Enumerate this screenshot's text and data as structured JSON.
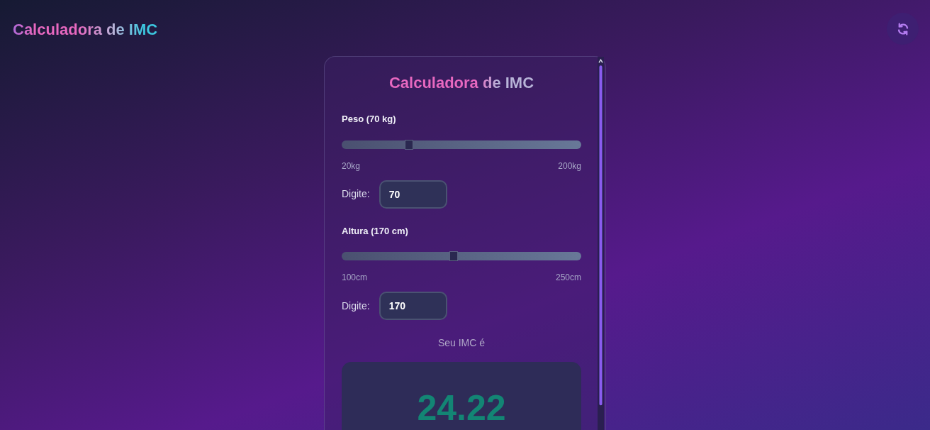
{
  "header": {
    "title": "Calculadora de IMC"
  },
  "card": {
    "title": "Calculadora de IMC",
    "sliders": [
      {
        "label": "Peso (70 kg)",
        "level": 0.28,
        "min_label": "20kg",
        "max_label": "200kg",
        "input_label": "Digite:",
        "value": "70"
      },
      {
        "label": "Altura (170 cm)",
        "level": 0.467,
        "min_label": "100cm",
        "max_label": "250cm",
        "input_label": "Digite:",
        "value": "170"
      }
    ],
    "result": {
      "caption": "Seu IMC é",
      "value": "24.22"
    }
  }
}
